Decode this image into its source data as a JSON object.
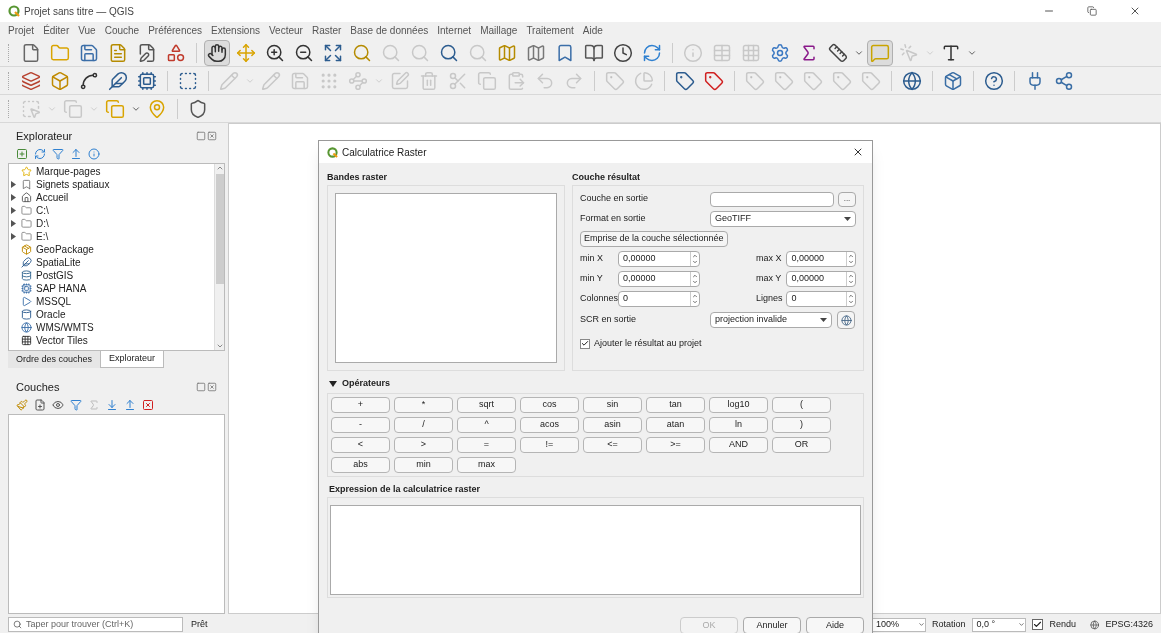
{
  "window": {
    "title": "Projet sans titre — QGIS"
  },
  "menu": [
    "Projet",
    "Éditer",
    "Vue",
    "Couche",
    "Préférences",
    "Extensions",
    "Vecteur",
    "Raster",
    "Base de données",
    "Internet",
    "Maillage",
    "Traitement",
    "Aide"
  ],
  "toolbars": [
    [
      {
        "selected": false,
        "disabled": false
      },
      {
        "selected": false,
        "disabled": false
      },
      {
        "selected": false,
        "disabled": false
      },
      {
        "selected": false,
        "disabled": false
      },
      {
        "selected": false,
        "disabled": false
      },
      {
        "selected": false,
        "disabled": false
      },
      {
        "selected": true,
        "disabled": false
      },
      {
        "selected": false,
        "disabled": false
      },
      {
        "selected": false,
        "disabled": false
      },
      {
        "selected": false,
        "disabled": false
      },
      {
        "selected": false,
        "disabled": false
      },
      {
        "selected": false,
        "disabled": false
      },
      {
        "selected": false,
        "disabled": true
      },
      {
        "selected": false,
        "disabled": true
      },
      {
        "selected": false,
        "disabled": false
      },
      {
        "selected": false,
        "disabled": true
      },
      {
        "selected": false,
        "disabled": false
      },
      {
        "selected": false,
        "disabled": false
      },
      {
        "selected": false,
        "disabled": false
      },
      {
        "selected": false,
        "disabled": false
      },
      {
        "selected": false,
        "disabled": false
      },
      {
        "selected": false,
        "disabled": false
      },
      {
        "selected": false,
        "disabled": true
      },
      {
        "selected": false,
        "disabled": true
      },
      {
        "selected": false,
        "disabled": true
      },
      {
        "selected": false,
        "disabled": false
      },
      {
        "selected": false,
        "disabled": false
      },
      {
        "selected": false,
        "disabled": false
      },
      {
        "selected": true,
        "disabled": false
      },
      {
        "selected": false,
        "disabled": true
      },
      {
        "selected": false,
        "disabled": false
      }
    ],
    [
      {
        "selected": false,
        "disabled": false
      },
      {
        "selected": false,
        "disabled": false
      },
      {
        "selected": false,
        "disabled": false
      },
      {
        "selected": false,
        "disabled": false
      },
      {
        "selected": false,
        "disabled": false
      },
      {
        "selected": false,
        "disabled": false
      },
      {
        "selected": false,
        "disabled": true
      },
      {
        "selected": false,
        "disabled": true
      },
      {
        "selected": false,
        "disabled": true
      },
      {
        "selected": false,
        "disabled": true
      },
      {
        "selected": false,
        "disabled": true
      },
      {
        "selected": false,
        "disabled": true
      },
      {
        "selected": false,
        "disabled": true
      },
      {
        "selected": false,
        "disabled": true
      },
      {
        "selected": false,
        "disabled": true
      },
      {
        "selected": false,
        "disabled": true
      },
      {
        "selected": false,
        "disabled": true
      },
      {
        "selected": false,
        "disabled": true
      },
      {
        "selected": false,
        "disabled": true
      },
      {
        "selected": false,
        "disabled": true
      },
      {
        "selected": false,
        "disabled": false
      },
      {
        "selected": false,
        "disabled": false
      },
      {
        "selected": false,
        "disabled": true
      },
      {
        "selected": false,
        "disabled": true
      },
      {
        "selected": false,
        "disabled": true
      },
      {
        "selected": false,
        "disabled": true
      },
      {
        "selected": false,
        "disabled": true
      },
      {
        "selected": false,
        "disabled": false
      },
      {
        "selected": false,
        "disabled": false
      },
      {
        "selected": false,
        "disabled": false
      },
      {
        "selected": false,
        "disabled": false
      },
      {
        "selected": false,
        "disabled": false
      }
    ],
    [
      {
        "selected": false,
        "disabled": true
      },
      {
        "selected": false,
        "disabled": true
      },
      {
        "selected": false,
        "disabled": false
      },
      {
        "selected": false,
        "disabled": false
      },
      {
        "selected": false,
        "disabled": false
      }
    ]
  ],
  "explorer_panel": {
    "title": "Explorateur",
    "items": [
      {
        "label": "Marque-pages",
        "expandable": false
      },
      {
        "label": "Signets spatiaux",
        "expandable": true
      },
      {
        "label": "Accueil",
        "expandable": true
      },
      {
        "label": "C:\\",
        "expandable": true
      },
      {
        "label": "D:\\",
        "expandable": true
      },
      {
        "label": "E:\\",
        "expandable": true
      },
      {
        "label": "GeoPackage",
        "expandable": false
      },
      {
        "label": "SpatiaLite",
        "expandable": false
      },
      {
        "label": "PostGIS",
        "expandable": false
      },
      {
        "label": "SAP HANA",
        "expandable": false
      },
      {
        "label": "MSSQL",
        "expandable": false
      },
      {
        "label": "Oracle",
        "expandable": false
      },
      {
        "label": "WMS/WMTS",
        "expandable": false
      },
      {
        "label": "Vector Tiles",
        "expandable": false
      }
    ]
  },
  "panel_tabs": [
    {
      "label": "Ordre des couches",
      "selected": false
    },
    {
      "label": "Explorateur",
      "selected": true
    }
  ],
  "layers_panel": {
    "title": "Couches"
  },
  "dialog": {
    "title": "Calculatrice Raster",
    "bands_section": {
      "title": "Bandes raster"
    },
    "result_section": {
      "title": "Couche résultat",
      "output_layer": {
        "label": "Couche en sortie",
        "browse": "..."
      },
      "output_format": {
        "label": "Format en sortie",
        "value": "GeoTIFF"
      },
      "extent_button": "Emprise de la couche sélectionnée",
      "spinboxes": [
        {
          "label": "min X",
          "value": "0,00000"
        },
        {
          "label": "max X",
          "value": "0,00000"
        },
        {
          "label": "min Y",
          "value": "0,00000"
        },
        {
          "label": "max Y",
          "value": "0,00000"
        },
        {
          "label": "Colonnes",
          "value": "0"
        },
        {
          "label": "Lignes",
          "value": "0"
        }
      ],
      "crs": {
        "label": "SCR en sortie",
        "value": "projection invalide"
      },
      "add_to_project": {
        "label": "Ajouter le résultat au projet",
        "checked": true
      }
    },
    "operators": {
      "title": "Opérateurs",
      "expanded": true,
      "buttons": [
        "+",
        "*",
        "sqrt",
        "cos",
        "sin",
        "tan",
        "log10",
        "(",
        "-",
        "/",
        "^",
        "acos",
        "asin",
        "atan",
        "ln",
        ")",
        "<",
        ">",
        "=",
        "!=",
        "<=",
        ">=",
        "AND",
        "OR",
        "abs",
        "min",
        "max"
      ]
    },
    "expression": {
      "title": "Expression de la calculatrice raster"
    },
    "buttons": [
      {
        "label": "OK",
        "disabled": true
      },
      {
        "label": "Annuler",
        "disabled": false
      },
      {
        "label": "Aide",
        "disabled": false
      }
    ]
  },
  "status_bar": {
    "search": {
      "placeholder": "Taper pour trouver (Ctrl+K)"
    },
    "message": "Prêt",
    "scale": "100%",
    "rotation_label": "Rotation",
    "rotation": "0,0 °",
    "render": {
      "label": "Rendu",
      "checked": true
    },
    "crs": "EPSG:4326"
  }
}
